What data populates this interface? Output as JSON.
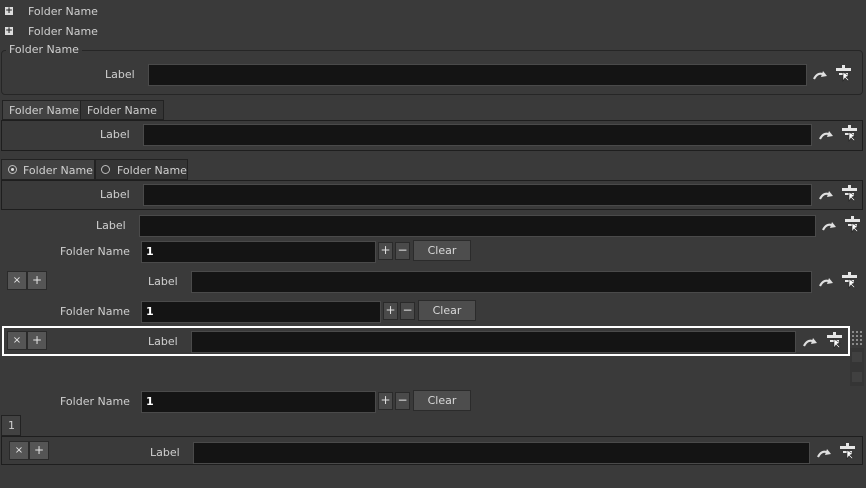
{
  "folders": {
    "collapsible_1": "Folder Name",
    "collapsible_2": "Folder Name",
    "group_title": "Folder Name",
    "tabs": [
      "Folder Name",
      "Folder Name"
    ],
    "radio_tabs": [
      "Folder Name",
      "Folder Name"
    ]
  },
  "fields": {
    "label": "Label"
  },
  "multiparm": {
    "label": "Folder Name",
    "value": "1",
    "plus": "+",
    "minus": "−",
    "clear": "Clear",
    "remove": "×",
    "insert": "+"
  },
  "tab_multiparm": {
    "tab": "1"
  },
  "icons": {
    "revert": "revert-arrow-icon",
    "channel": "channel-menu-icon",
    "handle": "resize-handle-icon"
  },
  "colors": {
    "background": "#3a3a3a",
    "field": "#141414",
    "highlight": "#ffffff"
  }
}
